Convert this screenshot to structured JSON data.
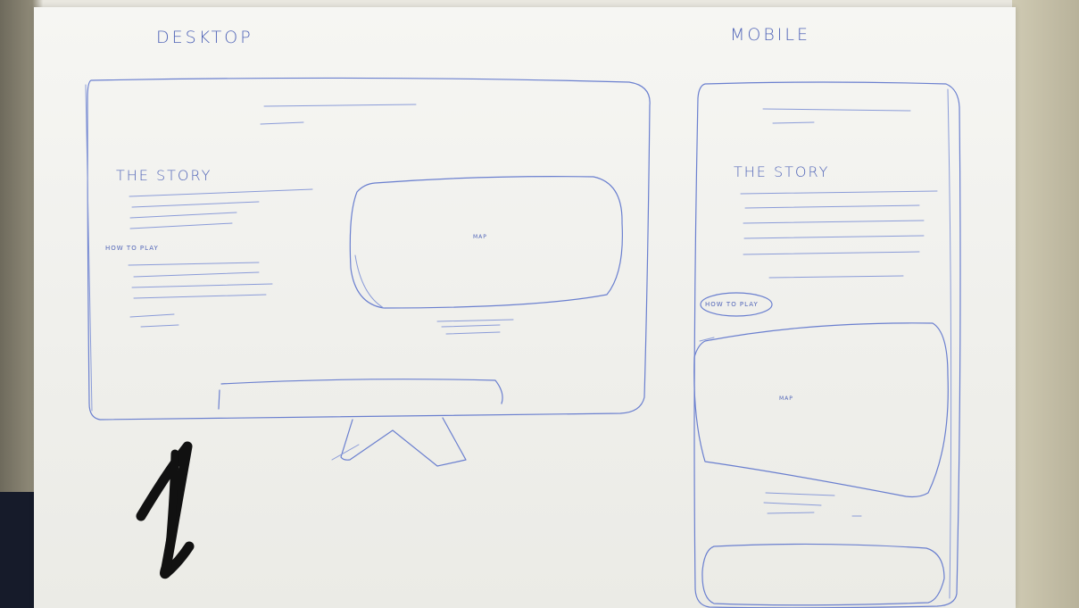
{
  "desktop": {
    "heading": "DESKTOP",
    "story": "THE STORY",
    "how_to_play": "HOW TO PLAY",
    "map": "MAP"
  },
  "mobile": {
    "heading": "MOBILE",
    "story": "THE STORY",
    "how_to_play": "HOW TO PLAY",
    "map": "MAP"
  },
  "page_number": "1",
  "colors": {
    "ink": "#6a7fcf",
    "marker": "#0d0d0d",
    "paper": "#f2f2ee"
  }
}
